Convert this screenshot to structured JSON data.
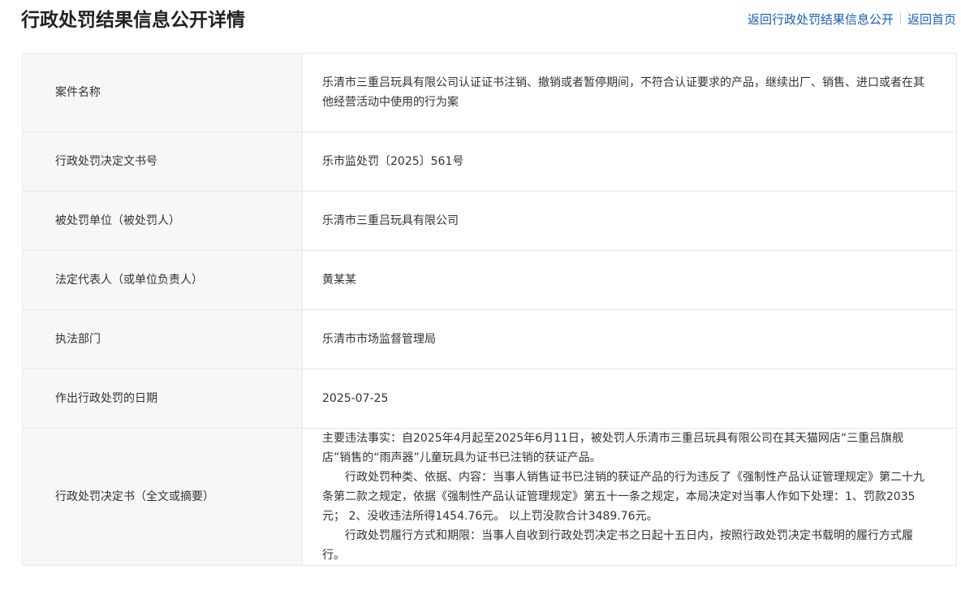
{
  "header": {
    "title": "行政处罚结果信息公开详情",
    "back_list_link": "返回行政处罚结果信息公开",
    "back_home_link": "返回首页"
  },
  "details": {
    "case_name": {
      "label": "案件名称",
      "value": "乐清市三重吕玩具有限公司认证证书注销、撤销或者暂停期间，不符合认证要求的产品，继续出厂、销售、进口或者在其他经营活动中使用的行为案"
    },
    "decision_number": {
      "label": "行政处罚决定文书号",
      "value": "乐市监处罚〔2025〕561号"
    },
    "penalized_party": {
      "label": "被处罚单位（被处罚人）",
      "value": "乐清市三重吕玩具有限公司"
    },
    "legal_representative": {
      "label": "法定代表人（或单位负责人）",
      "value": "黄某某"
    },
    "enforcement_department": {
      "label": "执法部门",
      "value": "乐清市市场监督管理局"
    },
    "decision_date": {
      "label": "作出行政处罚的日期",
      "value": "2025-07-25"
    },
    "decision_document": {
      "label": "行政处罚决定书（全文或摘要）",
      "paragraph_1": "主要违法事实：自2025年4月起至2025年6月11日，被处罚人乐清市三重吕玩具有限公司在其天猫网店“三重吕旗舰店”销售的“雨声器”儿童玩具为证书已注销的获证产品。",
      "paragraph_2": "行政处罚种类、依据、内容：当事人销售证书已注销的获证产品的行为违反了《强制性产品认证管理规定》第二十九条第二款之规定，依据《强制性产品认证管理规定》第五十一条之规定，本局决定对当事人作如下处理：1、罚款2035元； 2、没收违法所得1454.76元。 以上罚没款合计3489.76元。",
      "paragraph_3": "行政处罚履行方式和期限：当事人自收到行政处罚决定书之日起十五日内，按照行政处罚决定书载明的履行方式履行。"
    }
  },
  "colors": {
    "link": "#1a5fb4",
    "label_background": "#f7f7f7",
    "border": "#e8e8e8",
    "title": "#222222"
  }
}
